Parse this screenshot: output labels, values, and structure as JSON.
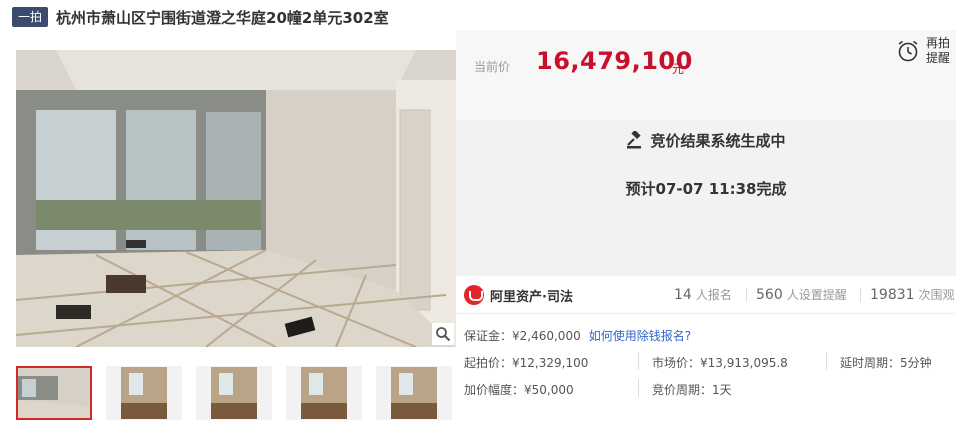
{
  "header": {
    "badge": "一拍",
    "title": "杭州市萧山区宁围街道澄之华庭20幢2单元302室"
  },
  "price": {
    "label": "当前价",
    "value": "16,479,100",
    "unit": "元"
  },
  "remind": {
    "label": "再拍提醒",
    "icon": "alarm-clock-icon"
  },
  "status": {
    "line1": "竞价结果系统生成中",
    "line2": "预计07-07 11:38完成",
    "icon": "gavel-icon"
  },
  "stats": {
    "brand": "阿里资产·司法",
    "signups_num": "14",
    "signups_label": "人报名",
    "reminders_num": "560",
    "reminders_label": "人设置提醒",
    "views_num": "19831",
    "views_label": "次围观"
  },
  "details": {
    "deposit": "保证金：¥2,460,000",
    "deposit_link": "如何使用除钱报名?",
    "start_price": "起拍价：¥12,329,100",
    "market_price": "市场价：¥13,913,095.8",
    "delay": "延时周期：5分钟",
    "increment": "加价幅度：¥50,000",
    "bid_period": "竞价周期：1天"
  },
  "colors": {
    "accent_red": "#c8102e",
    "badge_bg": "#3b4b6e",
    "link_blue": "#3366cc"
  }
}
